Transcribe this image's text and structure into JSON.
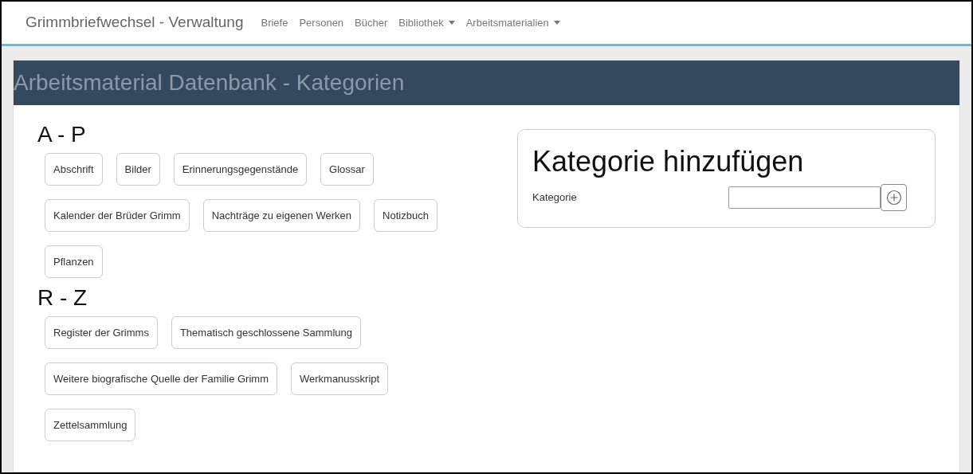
{
  "navbar": {
    "brand": "Grimmbriefwechsel - Verwaltung",
    "items": [
      {
        "label": "Briefe",
        "dropdown": false
      },
      {
        "label": "Personen",
        "dropdown": false
      },
      {
        "label": "Bücher",
        "dropdown": false
      },
      {
        "label": "Bibliothek",
        "dropdown": true
      },
      {
        "label": "Arbeitsmaterialien",
        "dropdown": true
      }
    ]
  },
  "page_title": "Arbeitsmaterial Datenbank - Kategorien",
  "groups": [
    {
      "heading": "A - P",
      "categories": [
        "Abschrift",
        "Bilder",
        "Erinnerungsgegenstände",
        "Glossar",
        "Kalender der Brüder Grimm",
        "Nachträge zu eigenen Werken",
        "Notizbuch",
        "Pflanzen"
      ]
    },
    {
      "heading": "R - Z",
      "categories": [
        "Register der Grimms",
        "Thematisch geschlossene Sammlung",
        "Weitere biografische Quelle der Familie Grimm",
        "Werkmanusskript",
        "Zettelsammlung"
      ]
    }
  ],
  "add_form": {
    "title": "Kategorie hinzufügen",
    "label": "Kategorie"
  }
}
